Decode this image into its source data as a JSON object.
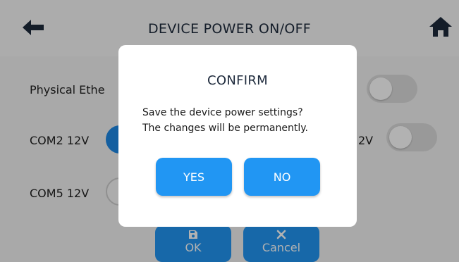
{
  "header": {
    "title": "DEVICE POWER ON/OFF"
  },
  "rows": [
    {
      "label": "Physical Ethe",
      "state": "off"
    },
    {
      "label": "COM2 12V",
      "state": "on"
    },
    {
      "label": "2V",
      "state": "off"
    },
    {
      "label": "COM5 12V",
      "state": "off"
    }
  ],
  "actions": {
    "ok_label": "OK",
    "cancel_label": "Cancel"
  },
  "dialog": {
    "title": "CONFIRM",
    "message_line1": "Save the device power settings?",
    "message_line2": "The changes will be permanently.",
    "yes_label": "YES",
    "no_label": "NO"
  },
  "colors": {
    "accent": "#2196f3",
    "title_text": "#1e2a3c",
    "overlay": "rgba(0,0,0,0.30)"
  },
  "icons": {
    "back": "arrow-left-icon",
    "home": "home-icon",
    "ok": "floppy-disk-icon",
    "cancel": "close-icon"
  }
}
